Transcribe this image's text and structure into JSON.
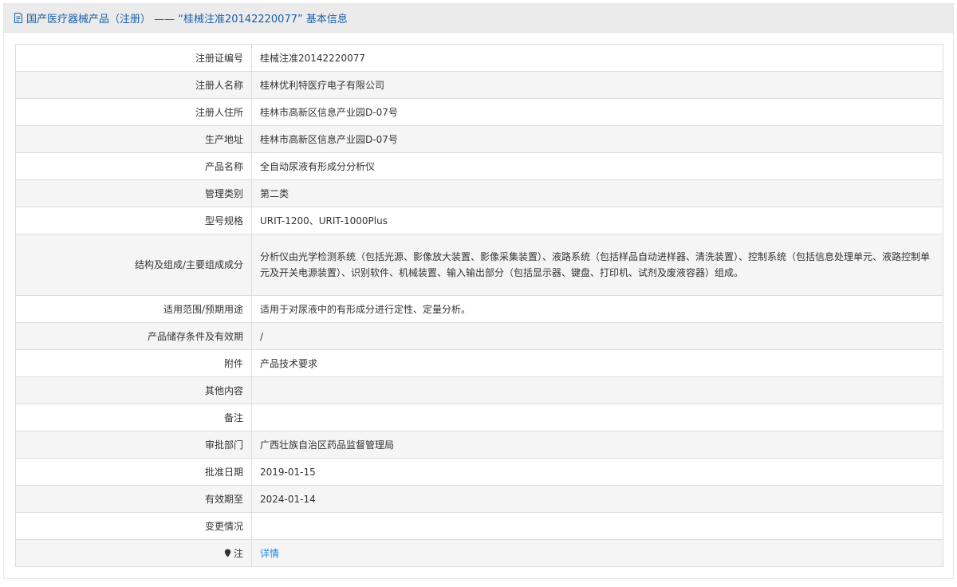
{
  "header": {
    "title": "国产医疗器械产品（注册）  ——  “桂械注准20142220077”  基本信息"
  },
  "rows": [
    {
      "label": "注册证编号",
      "value": "桂械注准20142220077"
    },
    {
      "label": "注册人名称",
      "value": "桂林优利特医疗电子有限公司"
    },
    {
      "label": "注册人住所",
      "value": "桂林市高新区信息产业园D-07号"
    },
    {
      "label": "生产地址",
      "value": "桂林市高新区信息产业园D-07号"
    },
    {
      "label": "产品名称",
      "value": "全自动尿液有形成分分析仪"
    },
    {
      "label": "管理类别",
      "value": "第二类"
    },
    {
      "label": "型号规格",
      "value": "URIT-1200、URIT-1000Plus"
    },
    {
      "label": "结构及组成/主要组成成分",
      "value": "分析仪由光学检测系统（包括光源、影像放大装置、影像采集装置）、液路系统（包括样品自动进样器、清洗装置）、控制系统（包括信息处理单元、液路控制单元及开关电源装置）、识别软件、机械装置、输入输出部分（包括显示器、键盘、打印机、试剂及废液容器）组成。"
    },
    {
      "label": "适用范围/预期用途",
      "value": "适用于对尿液中的有形成分进行定性、定量分析。"
    },
    {
      "label": "产品储存条件及有效期",
      "value": "/"
    },
    {
      "label": "附件",
      "value": "产品技术要求"
    },
    {
      "label": "其他内容",
      "value": ""
    },
    {
      "label": "备注",
      "value": ""
    },
    {
      "label": "审批部门",
      "value": "广西壮族自治区药品监督管理局"
    },
    {
      "label": "批准日期",
      "value": "2019-01-15"
    },
    {
      "label": "有效期至",
      "value": "2024-01-14"
    },
    {
      "label": "变更情况",
      "value": ""
    },
    {
      "label": "注",
      "value": "详情"
    }
  ],
  "icons": {
    "header": "document-icon",
    "note": "location-pin-icon"
  },
  "colors": {
    "header_text": "#1a5fa8",
    "link": "#1e88e5",
    "header_bg": "#ebebeb",
    "row_shade": "#f5f5f5"
  }
}
